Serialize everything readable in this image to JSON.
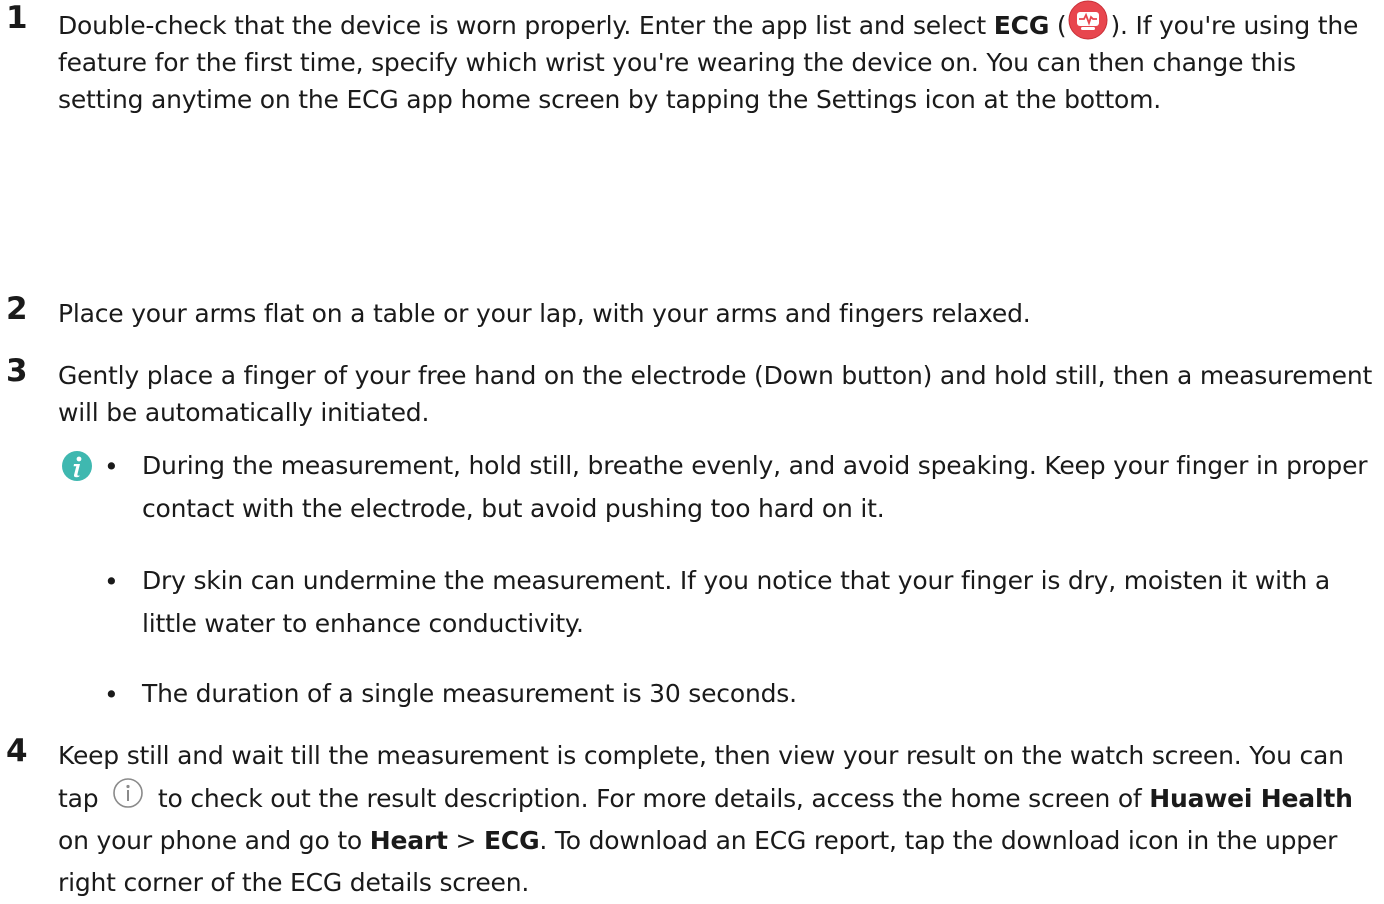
{
  "steps": [
    {
      "num": "1",
      "t1": "Double-check that the device is worn properly. Enter the app list and select ",
      "b1": "ECG",
      "t2": " (",
      "icon": "ecg-app-icon",
      "t3": "). If you're using the feature for the first time, specify which wrist you're wearing the device on. You can then change this setting anytime on the ECG app home screen by tapping the Settings icon at the bottom."
    },
    {
      "num": "2",
      "text": "Place your arms flat on a table or your lap, with your arms and fingers relaxed."
    },
    {
      "num": "3",
      "text": "Gently place a finger of your free hand on the electrode (Down button) and hold still, then a measurement will be automatically initiated."
    },
    {
      "num": "4",
      "t1": "Keep still and wait till the measurement is complete, then view your result on the watch screen. You can tap ",
      "icon": "info-icon",
      "t2": " to check out the result description. For more details, access the home screen of ",
      "b1": "Huawei Health",
      "t3": " on your phone and go to ",
      "b2": "Heart",
      "t4": " > ",
      "b3": "ECG",
      "t5": ". To download an ECG report, tap the download icon in the upper right corner of the ECG details screen."
    }
  ],
  "note": {
    "icon": "note-info-icon",
    "bullet_symbol": "•",
    "bullets": [
      "During the measurement, hold still, breathe evenly, and avoid speaking. Keep your finger in proper contact with the electrode, but avoid pushing too hard on it.",
      "Dry skin can undermine the measurement. If you notice that your finger is dry, moisten it with a little water to enhance conductivity.",
      "The duration of a single measurement is 30 seconds."
    ]
  },
  "colors": {
    "text": "#1a1a1a",
    "ecg_icon": "#e8464e",
    "note_icon": "#3fb8b0",
    "info_icon": "#8a8a8a"
  }
}
